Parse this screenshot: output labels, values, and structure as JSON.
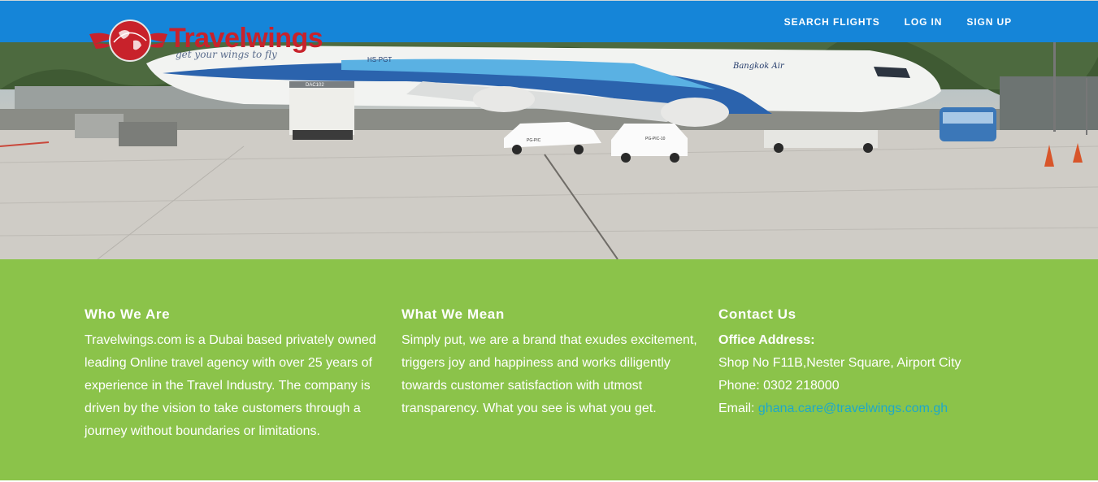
{
  "navbar": {
    "brand": "Travelwings",
    "tagline": "get your wings to fly",
    "links": [
      "SEARCH FLIGHTS",
      "LOG IN",
      "SIGN UP"
    ]
  },
  "hero": {
    "airline_text": "Bangkok Air",
    "registration": "HS-PGT",
    "vehicle_plate_1": "PG-PIC-10",
    "vehicle_plate_2": "PG-PIC",
    "truck_label": "DAC102"
  },
  "sections": {
    "who": {
      "title": "Who We Are",
      "body": "Travelwings.com is a Dubai based privately owned leading Online travel agency with over 25 years of experience in the Travel Industry. The company is driven by the vision to take customers through a journey without boundaries or limitations."
    },
    "mean": {
      "title": "What We Mean",
      "body": "Simply put, we are a brand that exudes excitement, triggers joy and happiness and works diligently towards customer satisfaction with utmost transparency. What you see is what you get."
    },
    "contact": {
      "title": "Contact Us",
      "office_label": "Office Address:",
      "address": "Shop No F11B,Nester Square, Airport City",
      "phone": "Phone: 0302 218000",
      "email_label": "Email:",
      "email": "ghana.care@travelwings.com.gh"
    }
  },
  "colors": {
    "navbar": "#1585d8",
    "info_band": "#8bc34a",
    "logo_red": "#c8222b",
    "email_link": "#1ea8c9"
  }
}
